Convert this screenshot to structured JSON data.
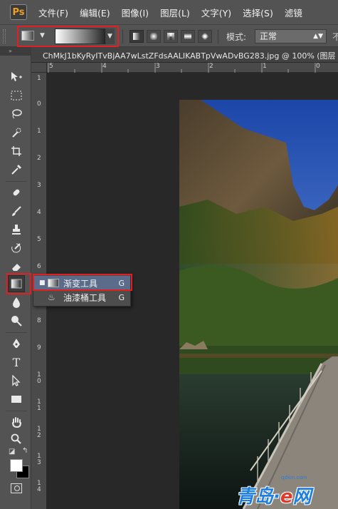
{
  "menubar": {
    "logo": "Ps",
    "items": [
      "文件(F)",
      "编辑(E)",
      "图像(I)",
      "图层(L)",
      "文字(Y)",
      "选择(S)",
      "滤镜"
    ]
  },
  "options": {
    "mode_label": "模式:",
    "mode_value": "正常",
    "trailing": "不"
  },
  "document": {
    "tab_title": "ChMkJ1bKyRyITvBjAA7wLstZFdsAALIKABTpVwADvBG283.jpg @ 100% (图层"
  },
  "ruler": {
    "h_labels": [
      "5",
      "4",
      "3",
      "2",
      "1",
      "0"
    ],
    "v_labels": [
      "1",
      "0",
      "1",
      "2",
      "3",
      "4",
      "5",
      "6",
      "7",
      "8",
      "9",
      "10",
      "11",
      "12",
      "13",
      "14"
    ]
  },
  "flyout": {
    "items": [
      {
        "label": "渐变工具",
        "key": "G"
      },
      {
        "label": "油漆桶工具",
        "key": "G"
      }
    ]
  },
  "watermark": {
    "text_cn": "青岛",
    "text_e": "e",
    "text_tail": "网",
    "small": "qdxin.com"
  }
}
